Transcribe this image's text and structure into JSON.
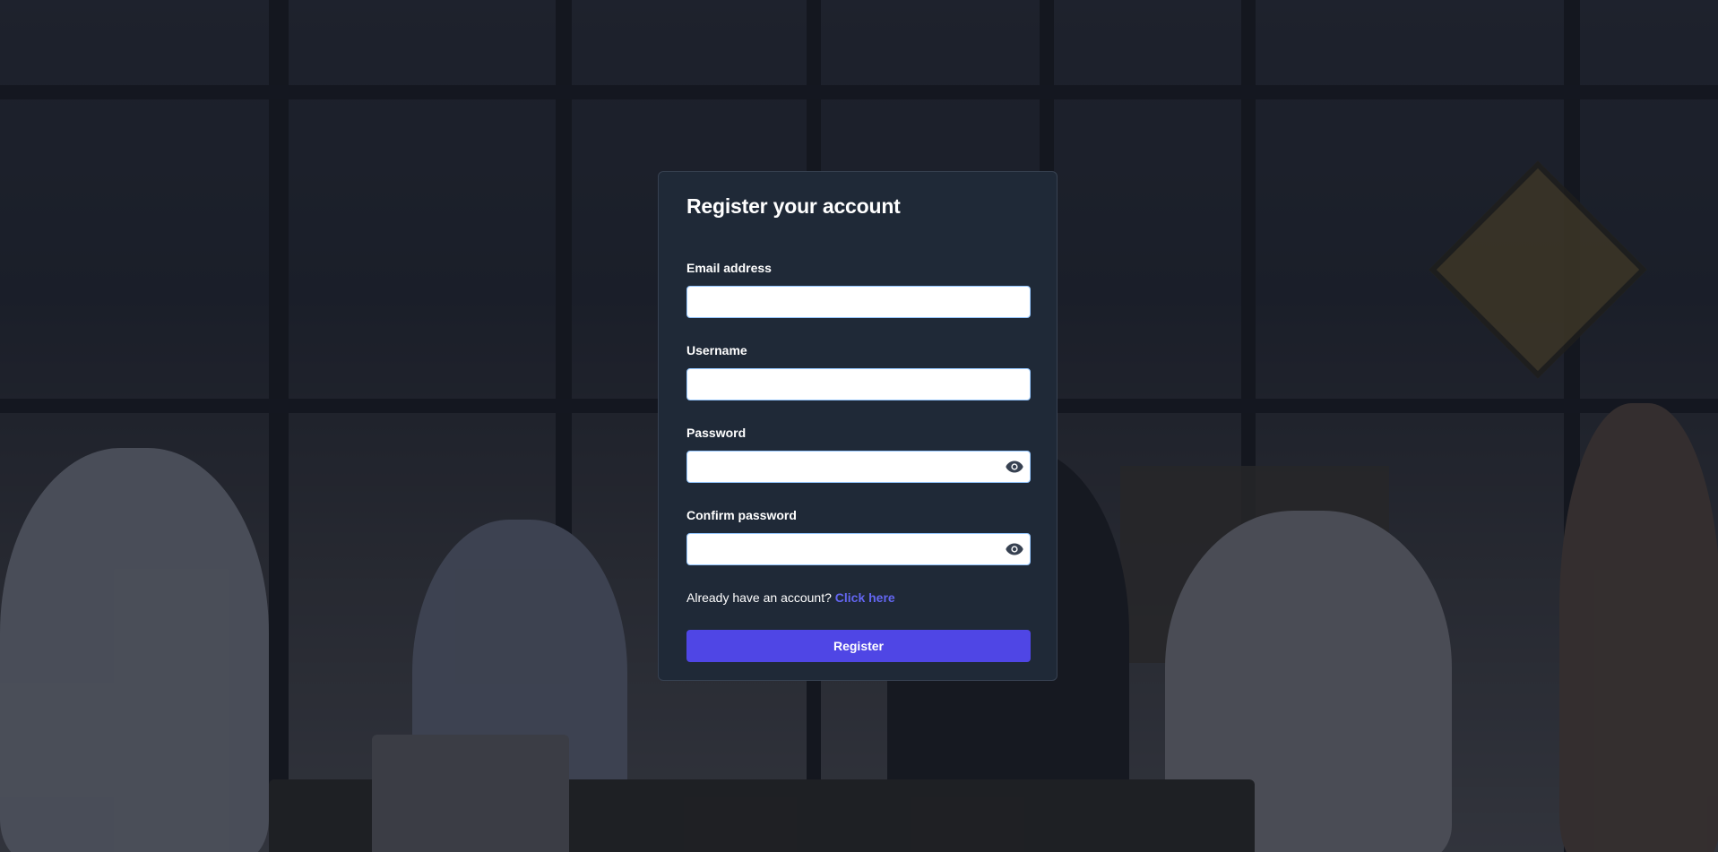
{
  "form": {
    "title": "Register your account",
    "email": {
      "label": "Email address",
      "value": "",
      "placeholder": ""
    },
    "username": {
      "label": "Username",
      "value": "",
      "placeholder": ""
    },
    "password": {
      "label": "Password",
      "value": "",
      "placeholder": "",
      "toggle_icon": "eye-icon"
    },
    "confirm_password": {
      "label": "Confirm password",
      "value": "",
      "placeholder": "",
      "toggle_icon": "eye-icon"
    },
    "account_prompt": "Already have an account?",
    "login_link": "Click here",
    "submit_label": "Register"
  },
  "colors": {
    "card_background": "#1f2937",
    "primary": "#4f46e5",
    "link": "#6366f1",
    "input_border": "#93c5fd"
  }
}
